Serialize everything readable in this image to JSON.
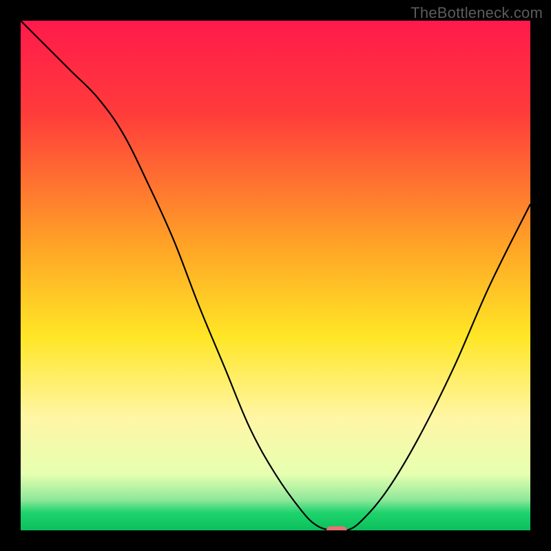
{
  "watermark": "TheBottleneck.com",
  "chart_data": {
    "type": "line",
    "title": "",
    "xlabel": "",
    "ylabel": "",
    "xlim": [
      0,
      100
    ],
    "ylim": [
      0,
      100
    ],
    "grid": false,
    "legend": false,
    "axes_visible": false,
    "background_gradient": {
      "stops": [
        {
          "pos": 0.0,
          "color": "#ff1a4b"
        },
        {
          "pos": 0.18,
          "color": "#ff3b3b"
        },
        {
          "pos": 0.45,
          "color": "#ffa726"
        },
        {
          "pos": 0.62,
          "color": "#ffe626"
        },
        {
          "pos": 0.78,
          "color": "#fff6a6"
        },
        {
          "pos": 0.89,
          "color": "#e6ffb0"
        },
        {
          "pos": 0.94,
          "color": "#8fe89a"
        },
        {
          "pos": 0.965,
          "color": "#1fd36d"
        },
        {
          "pos": 1.0,
          "color": "#0bbf5b"
        }
      ]
    },
    "series": [
      {
        "name": "bottleneck-curve",
        "x": [
          0,
          5,
          10,
          15,
          20,
          25,
          30,
          35,
          40,
          45,
          50,
          55,
          58,
          61,
          64,
          67,
          72,
          78,
          85,
          92,
          100
        ],
        "y": [
          100,
          95,
          90,
          85,
          78,
          68,
          57,
          44,
          32,
          20,
          11,
          4,
          1,
          0,
          0,
          2,
          8,
          18,
          32,
          48,
          64
        ]
      }
    ],
    "marker": {
      "x_center": 62,
      "y_center": 0,
      "width": 4,
      "height": 1.6,
      "color": "#e57373"
    }
  }
}
